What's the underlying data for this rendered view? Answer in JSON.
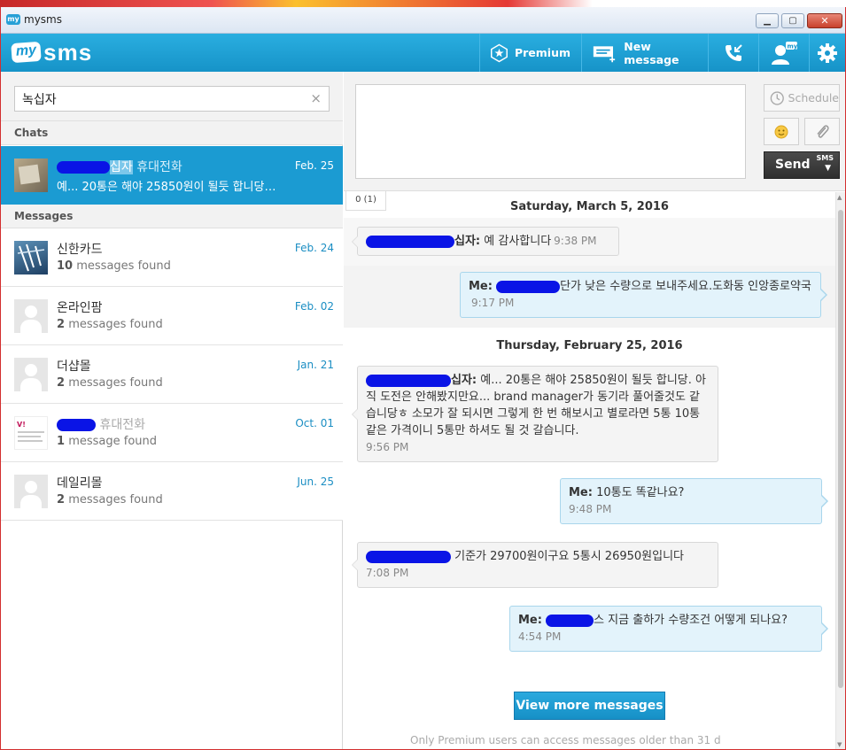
{
  "window": {
    "title": "mysms"
  },
  "header": {
    "logo_my": "my",
    "logo_sms": "sms",
    "premium_label": "Premium",
    "new_message_label": "New message"
  },
  "search": {
    "value": "녹십자",
    "clear": "×"
  },
  "sections": {
    "chats": "Chats",
    "messages": "Messages"
  },
  "chats": [
    {
      "name_visible": "십자",
      "name_suffix": "휴대전화",
      "preview": "예... 20통은 해야 25850원이 될듯 합니당. ...",
      "date": "Feb. 25"
    }
  ],
  "messages": [
    {
      "name": "신한카드",
      "count": "10",
      "found_label": "messages found",
      "date": "Feb. 24"
    },
    {
      "name": "온라인팜",
      "count": "2",
      "found_label": "messages found",
      "date": "Feb. 02"
    },
    {
      "name": "더샵몰",
      "count": "2",
      "found_label": "messages found",
      "date": "Jan. 21"
    },
    {
      "name": "휴대전화",
      "count": "1",
      "found_label": "message found",
      "date": "Oct. 01"
    },
    {
      "name": "데일리몰",
      "count": "2",
      "found_label": "messages found",
      "date": "Jun. 25"
    }
  ],
  "compose": {
    "schedule_label": "Schedule",
    "send_label": "Send",
    "send_type": "SMS",
    "counter": "0 (1)"
  },
  "conversation": {
    "days": [
      "Saturday, March 5, 2016",
      "Thursday, February 25, 2016"
    ],
    "bubbles": [
      {
        "dir": "in",
        "who_visible": "십자:",
        "text": "예 감사합니다",
        "time": "9:38 PM"
      },
      {
        "dir": "out",
        "who": "Me:",
        "text": "단가 낮은 수량으로 보내주세요.도화동 인앙종로약국",
        "time": "9:17 PM"
      },
      {
        "dir": "in",
        "who_visible": "십자:",
        "text": "예... 20통은 해야 25850원이 될듯 합니당. 아직 도전은 안해봤지만요... brand manager가 동기라 풀어줄것도 같습니당ㅎ 소모가 잘 되시면 그렇게 한 번 해보시고 별로라면 5통 10통 같은 가격이니 5통만 하셔도 될 것 갈습니다.",
        "time": "9:56 PM"
      },
      {
        "dir": "out",
        "who": "Me:",
        "text": "10통도 똑같나요?",
        "time": "9:48 PM"
      },
      {
        "dir": "in",
        "who_visible": "",
        "text": "기준가 29700원이구요 5통시 26950원입니다",
        "time": "7:08 PM"
      },
      {
        "dir": "out",
        "who": "Me:",
        "text": "스 지금 출하가 수량조건 어떻게 되나요?",
        "time": "4:54 PM"
      }
    ],
    "view_more_label": "View more messages",
    "footer_note": "Only Premium users can access messages older than 31 d"
  },
  "colors": {
    "accent": "#1b9bd2",
    "header": "#1f9fd6",
    "send": "#333333"
  }
}
